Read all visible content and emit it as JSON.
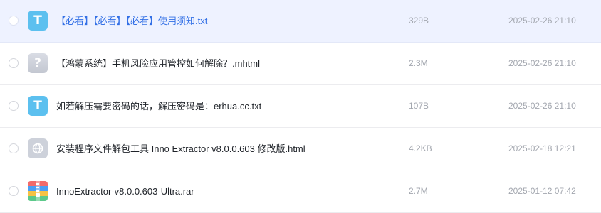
{
  "files": [
    {
      "name": "【必看】【必看】【必看】使用须知.txt",
      "size": "329B",
      "date": "2025-02-26 21:10",
      "icon": "txt-file-icon",
      "icon_glyph": "T",
      "selected": true
    },
    {
      "name": "【鸿蒙系统】手机风险应用管控如何解除？.mhtml",
      "size": "2.3M",
      "date": "2025-02-26 21:10",
      "icon": "unknown-file-icon",
      "icon_glyph": "?",
      "selected": false
    },
    {
      "name": "如若解压需要密码的话，解压密码是：erhua.cc.txt",
      "size": "107B",
      "date": "2025-02-26 21:10",
      "icon": "txt-file-icon",
      "icon_glyph": "T",
      "selected": false
    },
    {
      "name": "安装程序文件解包工具 Inno Extractor v8.0.0.603 修改版.html",
      "size": "4.2KB",
      "date": "2025-02-18 12:21",
      "icon": "html-file-icon",
      "icon_glyph": "",
      "selected": false
    },
    {
      "name": "InnoExtractor-v8.0.0.603-Ultra.rar",
      "size": "2.7M",
      "date": "2025-01-12 07:42",
      "icon": "rar-archive-icon",
      "icon_glyph": "",
      "selected": false
    }
  ],
  "colors": {
    "selected_row_bg": "#eef2ff",
    "selected_text": "#3370e6",
    "txt_icon": "#5cc0ef",
    "meta_text": "#a3a7af"
  }
}
